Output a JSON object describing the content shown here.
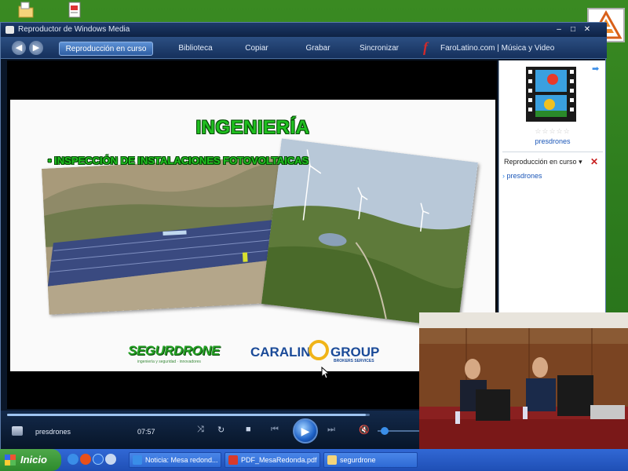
{
  "window": {
    "title": "Reproductor de Windows Media",
    "minimize_glyph": "–",
    "maximize_glyph": "□",
    "close_glyph": "✕"
  },
  "nav": {
    "back_glyph": "◀",
    "forward_glyph": "▶",
    "tabs": [
      {
        "label": "Reproducción en curso",
        "active": true
      },
      {
        "label": "Biblioteca"
      },
      {
        "label": "Copiar"
      },
      {
        "label": "Grabar"
      },
      {
        "label": "Sincronizar"
      },
      {
        "label": "FaroLatino.com | Música y Video"
      }
    ],
    "faro_glyph": "f"
  },
  "slide": {
    "title": "INGENIERÍA",
    "bullet": "• INSPECCIÓN DE INSTALACIONES FOTOVOLTAICAS",
    "logo_segurdrone": "SEGURDRONE",
    "logo_segurdrone_sub": "ingeniería y seguridad · innovadores",
    "logo_caralin": "CARALIN",
    "logo_group": "GROUP",
    "logo_brokers": "BROKERS SERVICES"
  },
  "right_pane": {
    "rating_stars": "☆☆☆☆☆",
    "media_name": "presdrones",
    "list_header": "Reproducción en curso",
    "list_dropdown_glyph": "▾",
    "list_close_glyph": "✕",
    "list_items": [
      "presdrones"
    ],
    "arrow_glyph": "➡"
  },
  "controls": {
    "media_name": "presdrones",
    "time": "07:57",
    "shuffle_glyph": "⤨",
    "repeat_glyph": "↻",
    "stop_glyph": "■",
    "prev_glyph": "⏮",
    "play_glyph": "▶",
    "next_glyph": "⏭",
    "mute_glyph": "🔇",
    "progress_fraction": 0.99,
    "volume_fraction": 0.2
  },
  "taskbar": {
    "start_label": "Inicio",
    "items": [
      {
        "label": "Noticia: Mesa redond...",
        "icon": "ie-icon"
      },
      {
        "label": "PDF_MesaRedonda.pdf",
        "icon": "pdf-icon"
      },
      {
        "label": "segurdrone",
        "icon": "folder-icon"
      }
    ]
  },
  "colors": {
    "accent": "#2d5da2",
    "slide_green": "#1fbf1f",
    "caralin_blue": "#1a4a98",
    "caralin_yellow": "#f0b418"
  }
}
